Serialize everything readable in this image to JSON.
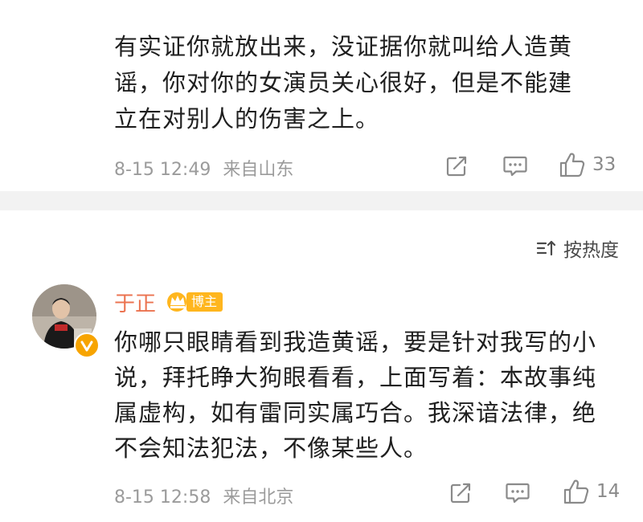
{
  "comment1": {
    "text": "有实证你就放出来，没证据你就叫给人造黄\n谣，你对你的女演员关心很好，但是不能建\n立在对别人的伤害之上。",
    "time": "8-15 12:49",
    "location": "来自山东",
    "likes": "33"
  },
  "sort": {
    "label": "按热度"
  },
  "comment2": {
    "username": "于正",
    "badge": "博主",
    "text": "你哪只眼睛看到我造黄谣，要是针对我写的小\n说，拜托睁大狗眼看看，上面写着：本故事纯\n属虚构，如有雷同实属巧合。我深谙法律，绝\n不会知法犯法，不像某些人。",
    "time": "8-15 12:58",
    "location": "来自北京",
    "likes": "14"
  },
  "colors": {
    "username": "#eb7350",
    "badge": "#ffb61e",
    "meta": "#9b9b9b",
    "divider": "#f2f2f2"
  },
  "icons": [
    "share-icon",
    "comment-icon",
    "thumbs-up-icon",
    "sort-icon",
    "crown-icon",
    "verified-icon"
  ]
}
